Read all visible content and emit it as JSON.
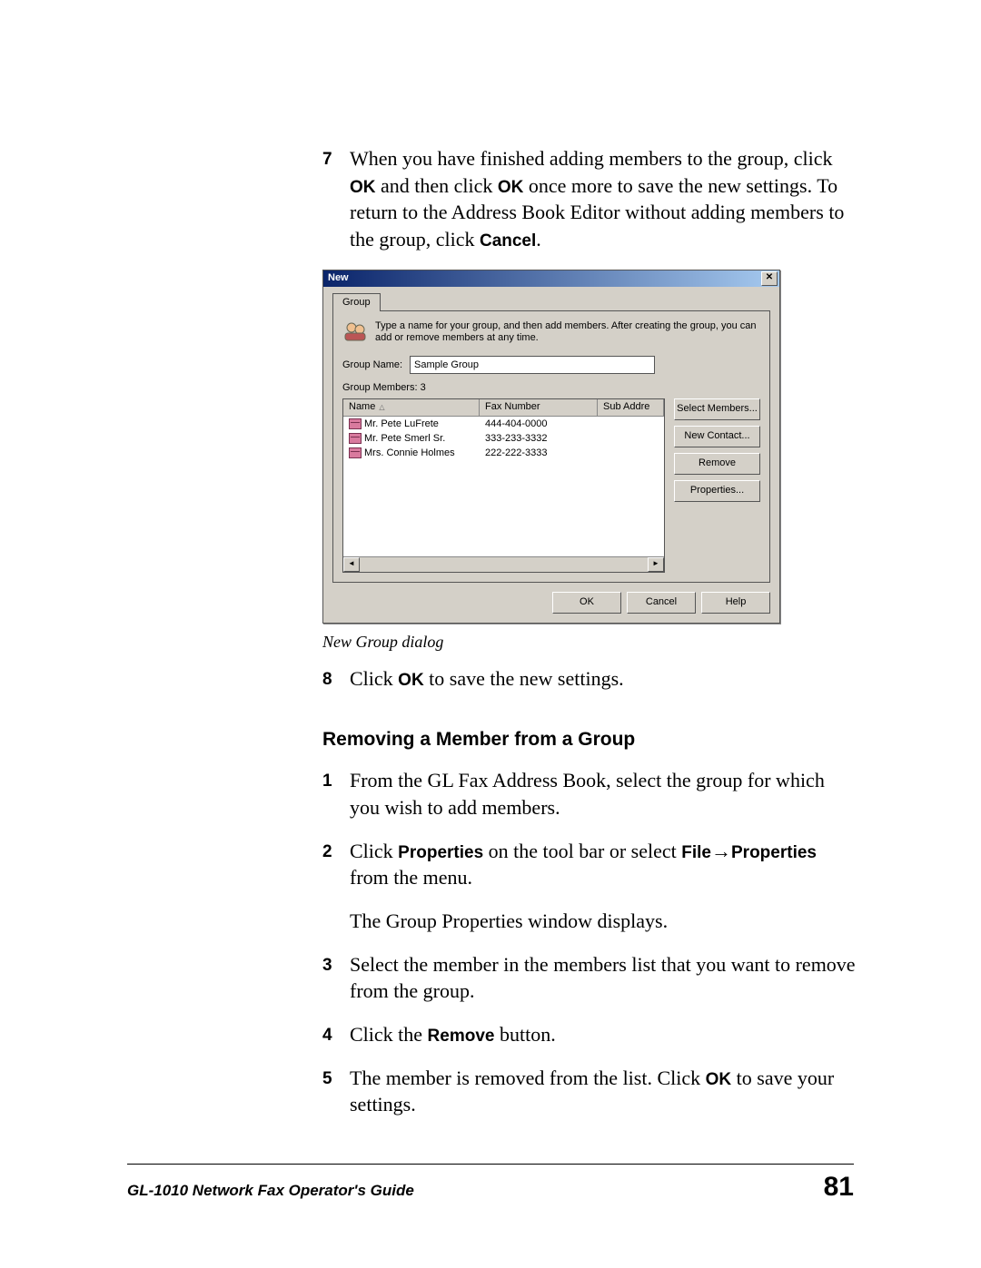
{
  "steps_top": {
    "num7": "7",
    "text7a": "When you have finished adding members to the group, click ",
    "ok1": "OK",
    "text7b": " and then click ",
    "ok2": "OK",
    "text7c": " once more to save the new settings. To return to the Address Book Editor without adding members to the group, click ",
    "cancel": "Cancel",
    "text7d": "."
  },
  "dialog": {
    "title": "New",
    "tab": "Group",
    "hint": "Type a name for your group, and then add members. After creating the group, you can add or remove members at any time.",
    "group_name_label": "Group Name:",
    "group_name_value": "Sample Group",
    "members_label": "Group Members: 3",
    "headers": {
      "name": "Name",
      "fax": "Fax Number",
      "sub": "Sub Addre"
    },
    "rows": [
      {
        "name": "Mr. Pete LuFrete",
        "fax": "444-404-0000"
      },
      {
        "name": "Mr. Pete Smerl Sr.",
        "fax": "333-233-3332"
      },
      {
        "name": "Mrs. Connie Holmes",
        "fax": "222-222-3333"
      }
    ],
    "side": {
      "select_members": "Select Members...",
      "new_contact": "New Contact...",
      "remove": "Remove",
      "properties": "Properties..."
    },
    "bottom": {
      "ok": "OK",
      "cancel": "Cancel",
      "help": "Help"
    }
  },
  "caption": "New Group dialog",
  "step8": {
    "num": "8",
    "pre": "Click ",
    "ok": "OK",
    "post": " to save the new settings."
  },
  "section_title": "Removing a Member from a Group",
  "remove_steps": {
    "n1": "1",
    "t1": "From the GL Fax Address Book, select the group for which you wish to add members.",
    "n2": "2",
    "t2a": "Click ",
    "t2b": "Properties",
    "t2c": " on the tool bar or select ",
    "t2d": "File",
    "arrow": "→",
    "t2e": "Properties",
    "t2f": " from the menu.",
    "t2p": "The Group Properties window displays.",
    "n3": "3",
    "t3": "Select the member in the members list that you want to remove from the group.",
    "n4": "4",
    "t4a": "Click the ",
    "t4b": "Remove",
    "t4c": " button.",
    "n5": "5",
    "t5a": "The member is removed from the list. Click ",
    "t5b": "OK",
    "t5c": " to save your settings."
  },
  "footer": {
    "title": "GL-1010 Network Fax Operator's Guide",
    "page": "81"
  }
}
